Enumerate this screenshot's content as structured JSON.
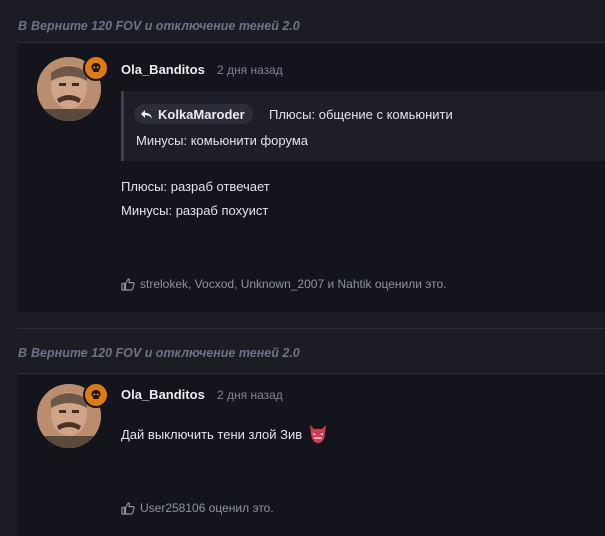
{
  "thread": {
    "prefix": "В",
    "title": "Верните 120 FOV и отключение теней 2.0"
  },
  "posts": [
    {
      "author": "Ola_Banditos",
      "time": "2 дня назад",
      "quote": {
        "author": "KolkaMaroder",
        "line1": "Плюсы: общение с комьюнити",
        "line2": "Минусы: комьюнити форума"
      },
      "body": [
        "Плюсы: разраб отвечает",
        "Минусы: разраб похуист"
      ],
      "reactions": "strelokek, Vocxod, Unknown_2007 и Nahtik оценили это."
    },
    {
      "author": "Ola_Banditos",
      "time": "2 дня назад",
      "body": [
        "Дай выключить тени злой Зив"
      ],
      "reactions": "User258106 оценил это."
    }
  ],
  "colors": {
    "background": "#1b1c24",
    "card": "#14151c",
    "badge": "#e07b12",
    "muted": "#6e7487"
  }
}
